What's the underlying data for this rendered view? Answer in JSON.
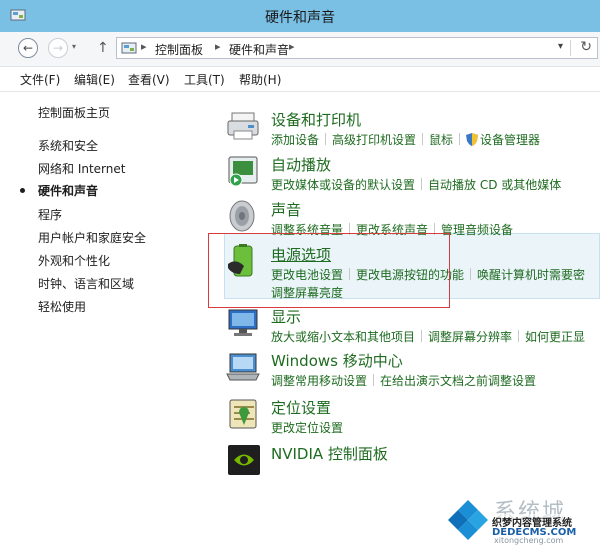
{
  "window": {
    "title": "硬件和声音"
  },
  "address": {
    "crumbs": [
      "控制面板",
      "硬件和声音"
    ]
  },
  "menu": [
    "文件(F)",
    "编辑(E)",
    "查看(V)",
    "工具(T)",
    "帮助(H)"
  ],
  "sidebar": {
    "items": [
      {
        "label": "控制面板主页"
      },
      {
        "label": "系统和安全"
      },
      {
        "label": "网络和 Internet"
      },
      {
        "label": "硬件和声音"
      },
      {
        "label": "程序"
      },
      {
        "label": "用户帐户和家庭安全"
      },
      {
        "label": "外观和个性化"
      },
      {
        "label": "时钟、语言和区域"
      },
      {
        "label": "轻松使用"
      }
    ]
  },
  "categories": [
    {
      "title": "设备和打印机",
      "icon": "printer-icon",
      "links": [
        "添加设备",
        "高级打印机设置",
        "鼠标",
        "设备管理器"
      ]
    },
    {
      "title": "自动播放",
      "icon": "autoplay-icon",
      "links": [
        "更改媒体或设备的默认设置",
        "自动播放 CD 或其他媒体"
      ]
    },
    {
      "title": "声音",
      "icon": "speaker-icon",
      "links": [
        "调整系统音量",
        "更改系统声音",
        "管理音频设备"
      ]
    },
    {
      "title": "电源选项",
      "icon": "battery-icon",
      "links": [
        "更改电池设置",
        "更改电源按钮的功能",
        "唤醒计算机时需要密"
      ],
      "links2": [
        "调整屏幕亮度"
      ]
    },
    {
      "title": "显示",
      "icon": "display-icon",
      "links": [
        "放大或缩小文本和其他项目",
        "调整屏幕分辨率",
        "如何更正显"
      ]
    },
    {
      "title": "Windows 移动中心",
      "icon": "mobility-center-icon",
      "links": [
        "调整常用移动设置",
        "在给出演示文档之前调整设置"
      ]
    },
    {
      "title": "定位设置",
      "icon": "location-icon",
      "links": [
        "更改定位设置"
      ]
    },
    {
      "title": "NVIDIA 控制面板",
      "icon": "nvidia-icon",
      "links": []
    }
  ],
  "watermark": {
    "text1": "系统城",
    "text2": "织梦内容管理系统",
    "text3": "DEDECMS.COM",
    "text4": "xitongcheng.com"
  },
  "colors": {
    "titlebar": "#7ac0e4",
    "link_green": "#1e6b20",
    "highlight": "#eaf4f9",
    "annotation_red": "#d83b3b"
  }
}
